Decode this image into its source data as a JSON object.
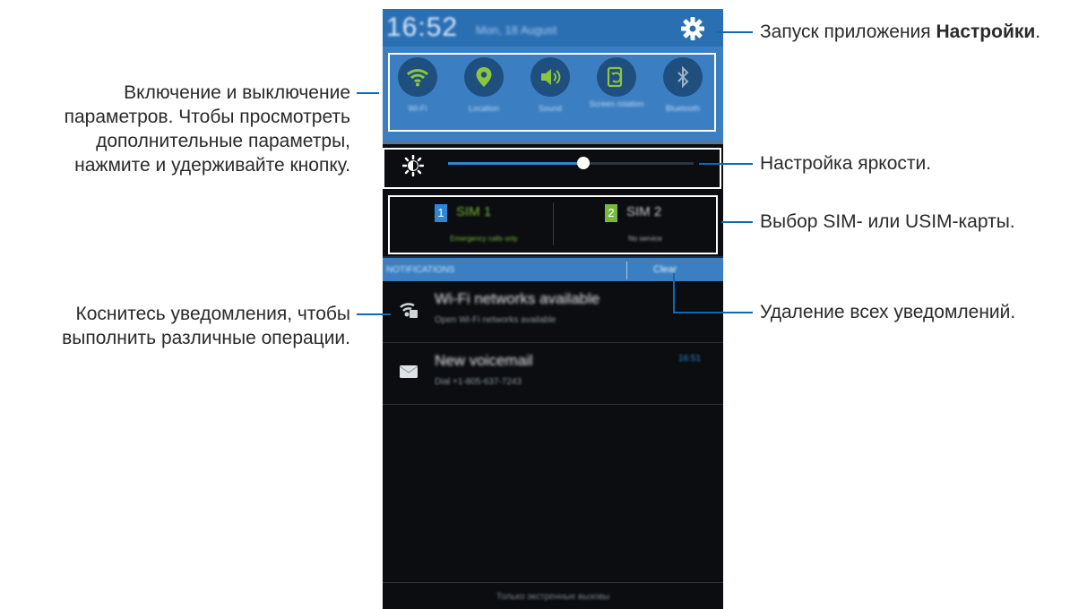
{
  "phone": {
    "status_bar": {
      "time": "16:52",
      "date": "Mon, 18 August"
    },
    "quick_settings": [
      {
        "label": "Wi-Fi",
        "icon": "wifi-icon",
        "active": true
      },
      {
        "label": "Location",
        "icon": "location-pin-icon",
        "active": true
      },
      {
        "label": "Sound",
        "icon": "speaker-icon",
        "active": true
      },
      {
        "label": "Screen rotation",
        "icon": "rotation-icon",
        "active": true
      },
      {
        "label": "Bluetooth",
        "icon": "bluetooth-icon",
        "active": false
      }
    ],
    "brightness": {
      "level": 0.55,
      "icon": "brightness-sun-icon"
    },
    "sims": [
      {
        "badge": "1",
        "name": "SIM 1",
        "status": "Emergency calls only",
        "badge_color": "#2e86d6",
        "name_color": "#78b83a"
      },
      {
        "badge": "2",
        "name": "SIM 2",
        "status": "No service",
        "badge_color": "#78b83a",
        "name_color": "#c9cdd1"
      }
    ],
    "notifications_header": {
      "title": "NOTIFICATIONS",
      "clear": "Clear"
    },
    "notifications": [
      {
        "icon": "wifi-notification-icon",
        "title": "Wi-Fi networks available",
        "subtitle": "Open Wi-Fi networks available",
        "time": ""
      },
      {
        "icon": "voicemail-icon",
        "title": "New voicemail",
        "subtitle": "Dial +1-805-637-7243",
        "time": "16:51"
      }
    ],
    "bottom_text": "Только экстренные вызовы"
  },
  "callouts": {
    "settings_prefix": "Запуск приложения ",
    "settings_bold": "Настройки",
    "settings_suffix": ".",
    "toggles_line1": "Включение и выключение",
    "toggles_line2": "параметров. Чтобы просмотреть",
    "toggles_line3": "дополнительные параметры,",
    "toggles_line4": "нажмите и удерживайте кнопку.",
    "brightness": "Настройка яркости.",
    "sim": "Выбор SIM- или USIM-карты.",
    "clear": "Удаление всех уведомлений.",
    "notif_line1": "Коснитесь уведомления, чтобы",
    "notif_line2": "выполнить различные операции."
  },
  "colors": {
    "accent": "#2b6fb3",
    "callout_line": "#0e6ab5",
    "toggle_active": "#8cc63f"
  }
}
